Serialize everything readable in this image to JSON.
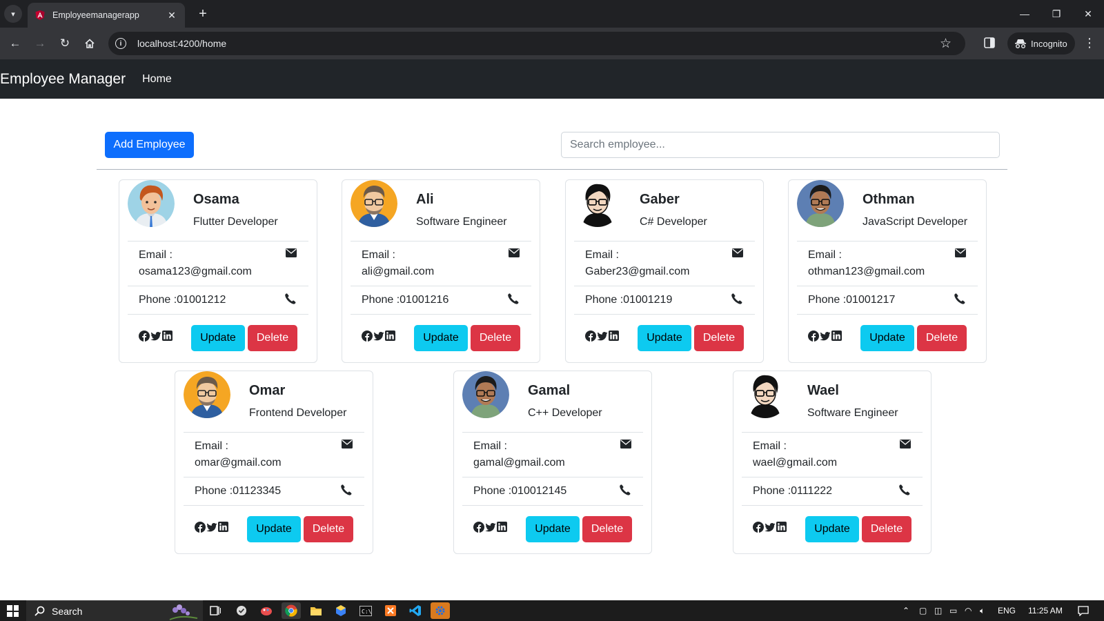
{
  "browser": {
    "tab_title": "Employeemanagerapp",
    "url": "localhost:4200/home",
    "incognito_label": "Incognito",
    "new_tab_symbol": "+",
    "tab_close_symbol": "✕"
  },
  "navbar": {
    "brand": "Employee Manager",
    "home_link": "Home"
  },
  "actions": {
    "add_label": "Add Employee",
    "search_placeholder": "Search employee..."
  },
  "card_labels": {
    "email_label": "Email :",
    "update": "Update",
    "delete": "Delete"
  },
  "employees": [
    {
      "name": "Osama",
      "title": "Flutter Developer",
      "email": "osama123@gmail.com",
      "phone": "Phone :01001212",
      "avatar": "avatar-redhair-icon"
    },
    {
      "name": "Ali",
      "title": "Software Engineer",
      "email": "ali@gmail.com",
      "phone": "Phone :01001216",
      "avatar": "avatar-glasses-orange-icon"
    },
    {
      "name": "Gaber",
      "title": "C# Developer",
      "email": "Gaber23@gmail.com",
      "phone": "Phone :01001219",
      "avatar": "avatar-glasses-bw-icon"
    },
    {
      "name": "Othman",
      "title": "JavaScript Developer",
      "email": "othman123@gmail.com",
      "phone": "Phone :01001217",
      "avatar": "avatar-glasses-blue-icon"
    },
    {
      "name": "Omar",
      "title": "Frontend Developer",
      "email": "omar@gmail.com",
      "phone": "Phone :01123345",
      "avatar": "avatar-glasses-orange-icon"
    },
    {
      "name": "Gamal",
      "title": "C++ Developer",
      "email": "gamal@gmail.com",
      "phone": "Phone :010012145",
      "avatar": "avatar-glasses-blue-icon"
    },
    {
      "name": "Wael",
      "title": "Software Engineer",
      "email": "wael@gmail.com",
      "phone": "Phone :0111222",
      "avatar": "avatar-glasses-bw-icon"
    }
  ],
  "taskbar": {
    "search_label": "Search",
    "language": "ENG",
    "time": "11:25 AM"
  },
  "colors": {
    "primary": "#0d6efd",
    "info": "#0dcaf0",
    "danger": "#dc3545",
    "navbar_bg": "#212529"
  }
}
